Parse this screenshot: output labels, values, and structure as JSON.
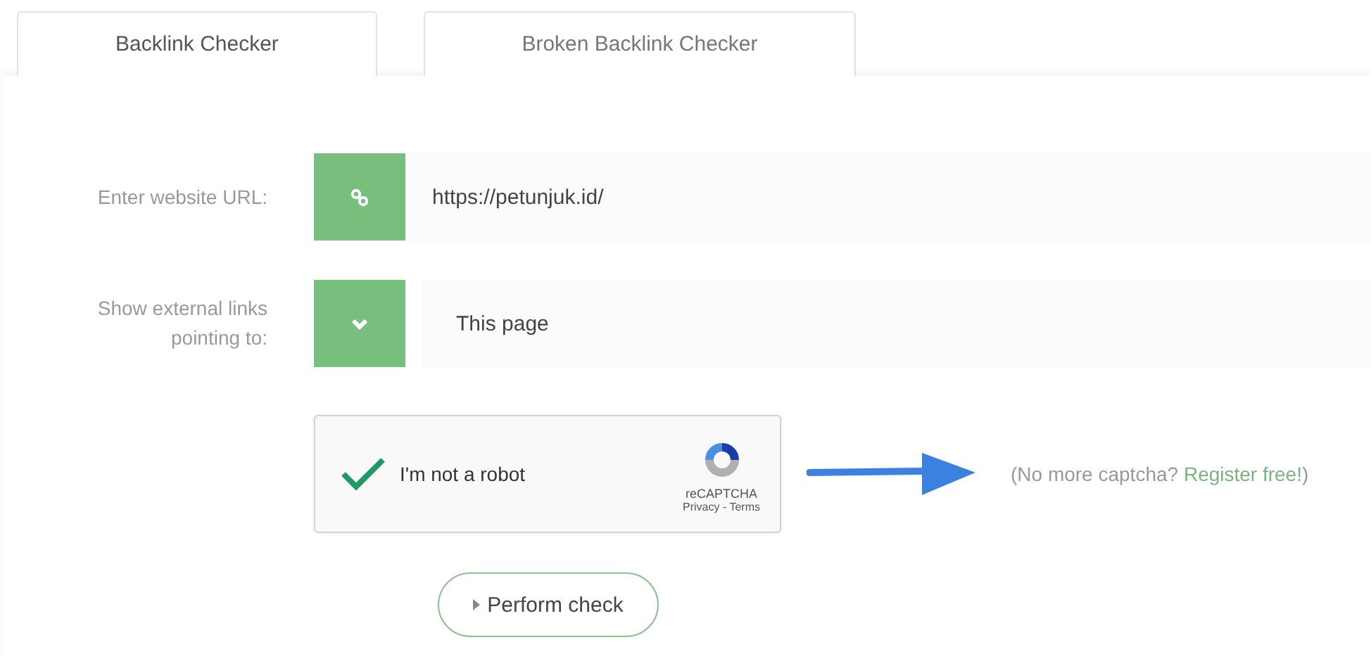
{
  "tabs": [
    {
      "label": "Backlink Checker",
      "selected": true
    },
    {
      "label": "Broken Backlink Checker",
      "selected": false
    }
  ],
  "form": {
    "url_label": "Enter website URL:",
    "url_value": "https://petunjuk.id/",
    "scope_label": "Show external links pointing to:",
    "scope_value": "This page"
  },
  "captcha": {
    "checked": true,
    "label": "I'm not a robot",
    "brand": "reCAPTCHA",
    "links": "Privacy - Terms"
  },
  "register_note": {
    "before": "(No more captcha? ",
    "link": "Register free!",
    "after": ")"
  },
  "submit": {
    "label": "Perform check"
  }
}
